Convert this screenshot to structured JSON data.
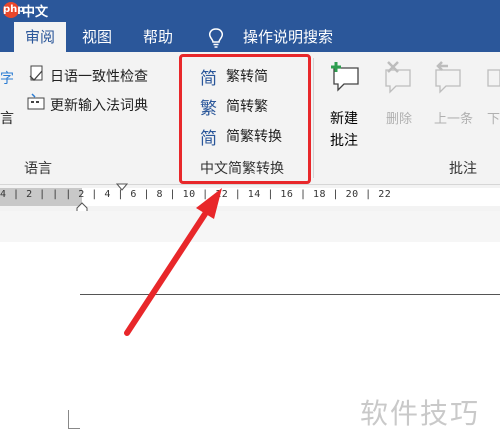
{
  "site_logo": {
    "text": "中文网",
    "mark": "php"
  },
  "tabs": [
    {
      "label": "审阅",
      "active": true
    },
    {
      "label": "视图"
    },
    {
      "label": "帮助"
    },
    {
      "label": "操作说明搜索"
    }
  ],
  "ribbon": {
    "language_group": {
      "label": "语言",
      "left_fragment_top": "字",
      "left_fragment_bottom": "言",
      "items": [
        "日语一致性检查",
        "更新输入法词典"
      ]
    },
    "chinese_conversion_group": {
      "label": "中文简繁转换",
      "items": [
        {
          "label": "繁转简",
          "icon": "simplify-icon",
          "glyph": "简"
        },
        {
          "label": "简转繁",
          "icon": "traditionalize-icon",
          "glyph": "繁"
        },
        {
          "label": "简繁转换",
          "icon": "convert-icon",
          "glyph": "简"
        }
      ]
    },
    "comments_group": {
      "label": "批注",
      "new_comment_line1": "新建",
      "new_comment_line2": "批注",
      "delete": "删除",
      "previous": "上一条",
      "next_fragment": "下"
    }
  },
  "ruler": {
    "text": "4 | 2 |   |  | 2 | 4 | 6 | 8 | 10 | 12 | 14 | 16 | 18 | 20 | 22"
  },
  "watermark": "软件技巧",
  "colors": {
    "accent": "#2b579a",
    "highlight": "#e8272a"
  }
}
